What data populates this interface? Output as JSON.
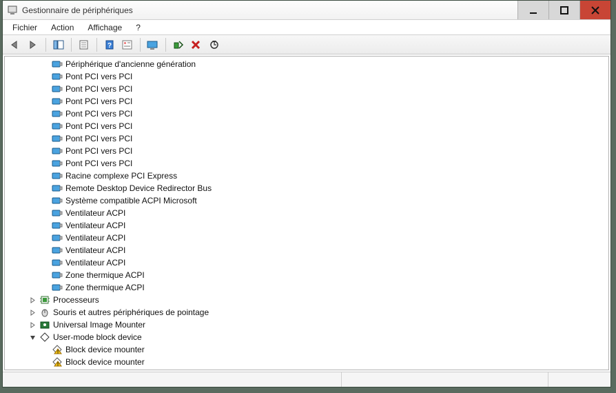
{
  "window": {
    "title": "Gestionnaire de périphériques"
  },
  "menu": {
    "items": [
      "Fichier",
      "Action",
      "Affichage",
      "?"
    ]
  },
  "toolbar": {
    "back": "back-icon",
    "forward": "forward-icon",
    "show_tree": "show-tree-icon",
    "properties": "properties-icon",
    "help": "help-icon",
    "show_hidden": "show-hidden-icon",
    "monitor": "monitor-icon",
    "add_device": "add-device-icon",
    "remove_device": "remove-device-icon",
    "scan": "scan-icon"
  },
  "tree": {
    "nodes": [
      {
        "depth": 3,
        "expander": "",
        "icon": "device-blue",
        "label": "Périphérique d'ancienne génération"
      },
      {
        "depth": 3,
        "expander": "",
        "icon": "device-blue",
        "label": "Pont PCI vers PCI"
      },
      {
        "depth": 3,
        "expander": "",
        "icon": "device-blue",
        "label": "Pont PCI vers PCI"
      },
      {
        "depth": 3,
        "expander": "",
        "icon": "device-blue",
        "label": "Pont PCI vers PCI"
      },
      {
        "depth": 3,
        "expander": "",
        "icon": "device-blue",
        "label": "Pont PCI vers PCI"
      },
      {
        "depth": 3,
        "expander": "",
        "icon": "device-blue",
        "label": "Pont PCI vers PCI"
      },
      {
        "depth": 3,
        "expander": "",
        "icon": "device-blue",
        "label": "Pont PCI vers PCI"
      },
      {
        "depth": 3,
        "expander": "",
        "icon": "device-blue",
        "label": "Pont PCI vers PCI"
      },
      {
        "depth": 3,
        "expander": "",
        "icon": "device-blue",
        "label": "Pont PCI vers PCI"
      },
      {
        "depth": 3,
        "expander": "",
        "icon": "device-blue",
        "label": "Racine complexe PCI Express"
      },
      {
        "depth": 3,
        "expander": "",
        "icon": "device-blue",
        "label": "Remote Desktop Device Redirector Bus"
      },
      {
        "depth": 3,
        "expander": "",
        "icon": "device-blue",
        "label": "Système compatible ACPI Microsoft"
      },
      {
        "depth": 3,
        "expander": "",
        "icon": "device-blue",
        "label": "Ventilateur ACPI"
      },
      {
        "depth": 3,
        "expander": "",
        "icon": "device-blue",
        "label": "Ventilateur ACPI"
      },
      {
        "depth": 3,
        "expander": "",
        "icon": "device-blue",
        "label": "Ventilateur ACPI"
      },
      {
        "depth": 3,
        "expander": "",
        "icon": "device-blue",
        "label": "Ventilateur ACPI"
      },
      {
        "depth": 3,
        "expander": "",
        "icon": "device-blue",
        "label": "Ventilateur ACPI"
      },
      {
        "depth": 3,
        "expander": "",
        "icon": "device-blue",
        "label": "Zone thermique ACPI"
      },
      {
        "depth": 3,
        "expander": "",
        "icon": "device-blue",
        "label": "Zone thermique ACPI"
      },
      {
        "depth": 2,
        "expander": ">",
        "icon": "cpu",
        "label": "Processeurs"
      },
      {
        "depth": 2,
        "expander": ">",
        "icon": "mouse",
        "label": "Souris et autres périphériques de pointage"
      },
      {
        "depth": 2,
        "expander": ">",
        "icon": "image-mounter",
        "label": "Universal Image Mounter"
      },
      {
        "depth": 2,
        "expander": "v",
        "icon": "diamond",
        "label": "User-mode block device"
      },
      {
        "depth": 3,
        "expander": "",
        "icon": "warn-device",
        "label": "Block device mounter"
      },
      {
        "depth": 3,
        "expander": "",
        "icon": "warn-device",
        "label": "Block device mounter"
      }
    ]
  }
}
